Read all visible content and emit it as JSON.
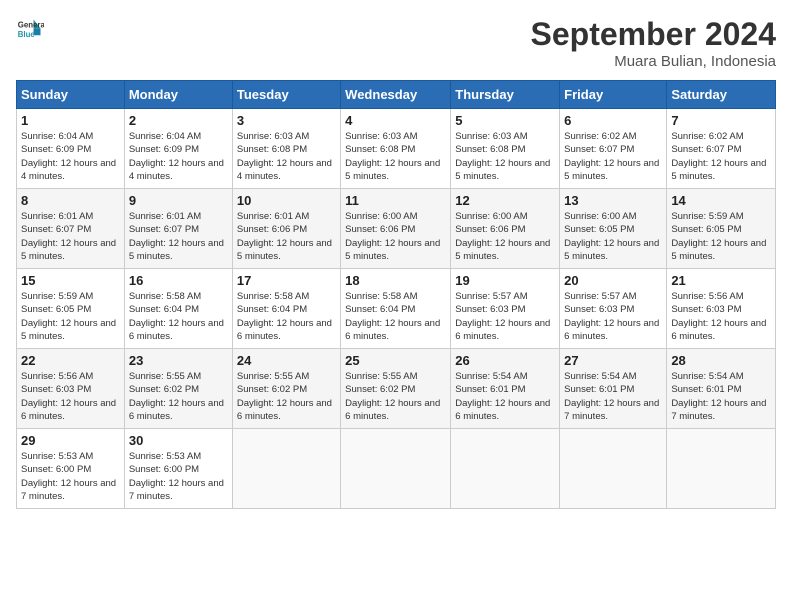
{
  "logo": {
    "line1": "General",
    "line2": "Blue"
  },
  "title": "September 2024",
  "location": "Muara Bulian, Indonesia",
  "days_of_week": [
    "Sunday",
    "Monday",
    "Tuesday",
    "Wednesday",
    "Thursday",
    "Friday",
    "Saturday"
  ],
  "weeks": [
    [
      {
        "num": "1",
        "rise": "6:04 AM",
        "set": "6:09 PM",
        "daylight": "12 hours and 4 minutes."
      },
      {
        "num": "2",
        "rise": "6:04 AM",
        "set": "6:09 PM",
        "daylight": "12 hours and 4 minutes."
      },
      {
        "num": "3",
        "rise": "6:03 AM",
        "set": "6:08 PM",
        "daylight": "12 hours and 4 minutes."
      },
      {
        "num": "4",
        "rise": "6:03 AM",
        "set": "6:08 PM",
        "daylight": "12 hours and 5 minutes."
      },
      {
        "num": "5",
        "rise": "6:03 AM",
        "set": "6:08 PM",
        "daylight": "12 hours and 5 minutes."
      },
      {
        "num": "6",
        "rise": "6:02 AM",
        "set": "6:07 PM",
        "daylight": "12 hours and 5 minutes."
      },
      {
        "num": "7",
        "rise": "6:02 AM",
        "set": "6:07 PM",
        "daylight": "12 hours and 5 minutes."
      }
    ],
    [
      {
        "num": "8",
        "rise": "6:01 AM",
        "set": "6:07 PM",
        "daylight": "12 hours and 5 minutes."
      },
      {
        "num": "9",
        "rise": "6:01 AM",
        "set": "6:07 PM",
        "daylight": "12 hours and 5 minutes."
      },
      {
        "num": "10",
        "rise": "6:01 AM",
        "set": "6:06 PM",
        "daylight": "12 hours and 5 minutes."
      },
      {
        "num": "11",
        "rise": "6:00 AM",
        "set": "6:06 PM",
        "daylight": "12 hours and 5 minutes."
      },
      {
        "num": "12",
        "rise": "6:00 AM",
        "set": "6:06 PM",
        "daylight": "12 hours and 5 minutes."
      },
      {
        "num": "13",
        "rise": "6:00 AM",
        "set": "6:05 PM",
        "daylight": "12 hours and 5 minutes."
      },
      {
        "num": "14",
        "rise": "5:59 AM",
        "set": "6:05 PM",
        "daylight": "12 hours and 5 minutes."
      }
    ],
    [
      {
        "num": "15",
        "rise": "5:59 AM",
        "set": "6:05 PM",
        "daylight": "12 hours and 5 minutes."
      },
      {
        "num": "16",
        "rise": "5:58 AM",
        "set": "6:04 PM",
        "daylight": "12 hours and 6 minutes."
      },
      {
        "num": "17",
        "rise": "5:58 AM",
        "set": "6:04 PM",
        "daylight": "12 hours and 6 minutes."
      },
      {
        "num": "18",
        "rise": "5:58 AM",
        "set": "6:04 PM",
        "daylight": "12 hours and 6 minutes."
      },
      {
        "num": "19",
        "rise": "5:57 AM",
        "set": "6:03 PM",
        "daylight": "12 hours and 6 minutes."
      },
      {
        "num": "20",
        "rise": "5:57 AM",
        "set": "6:03 PM",
        "daylight": "12 hours and 6 minutes."
      },
      {
        "num": "21",
        "rise": "5:56 AM",
        "set": "6:03 PM",
        "daylight": "12 hours and 6 minutes."
      }
    ],
    [
      {
        "num": "22",
        "rise": "5:56 AM",
        "set": "6:03 PM",
        "daylight": "12 hours and 6 minutes."
      },
      {
        "num": "23",
        "rise": "5:55 AM",
        "set": "6:02 PM",
        "daylight": "12 hours and 6 minutes."
      },
      {
        "num": "24",
        "rise": "5:55 AM",
        "set": "6:02 PM",
        "daylight": "12 hours and 6 minutes."
      },
      {
        "num": "25",
        "rise": "5:55 AM",
        "set": "6:02 PM",
        "daylight": "12 hours and 6 minutes."
      },
      {
        "num": "26",
        "rise": "5:54 AM",
        "set": "6:01 PM",
        "daylight": "12 hours and 6 minutes."
      },
      {
        "num": "27",
        "rise": "5:54 AM",
        "set": "6:01 PM",
        "daylight": "12 hours and 7 minutes."
      },
      {
        "num": "28",
        "rise": "5:54 AM",
        "set": "6:01 PM",
        "daylight": "12 hours and 7 minutes."
      }
    ],
    [
      {
        "num": "29",
        "rise": "5:53 AM",
        "set": "6:00 PM",
        "daylight": "12 hours and 7 minutes."
      },
      {
        "num": "30",
        "rise": "5:53 AM",
        "set": "6:00 PM",
        "daylight": "12 hours and 7 minutes."
      },
      null,
      null,
      null,
      null,
      null
    ]
  ]
}
